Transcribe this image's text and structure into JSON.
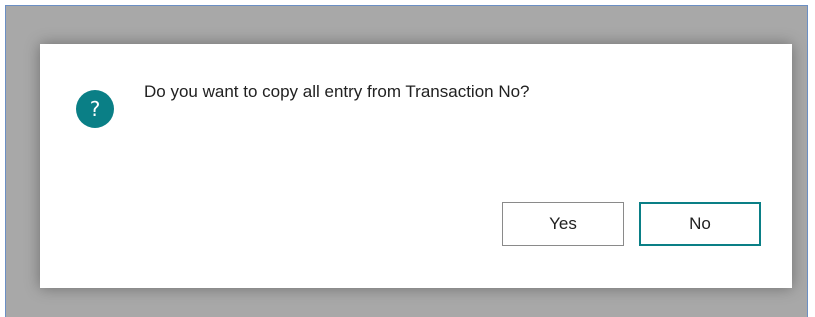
{
  "dialog": {
    "icon": "question-icon",
    "icon_glyph": "?",
    "message": "Do you want to copy all entry from Transaction No?",
    "buttons": {
      "yes_label": "Yes",
      "no_label": "No"
    }
  },
  "colors": {
    "accent": "#0a7f86",
    "backdrop": "#a8a8a8"
  }
}
